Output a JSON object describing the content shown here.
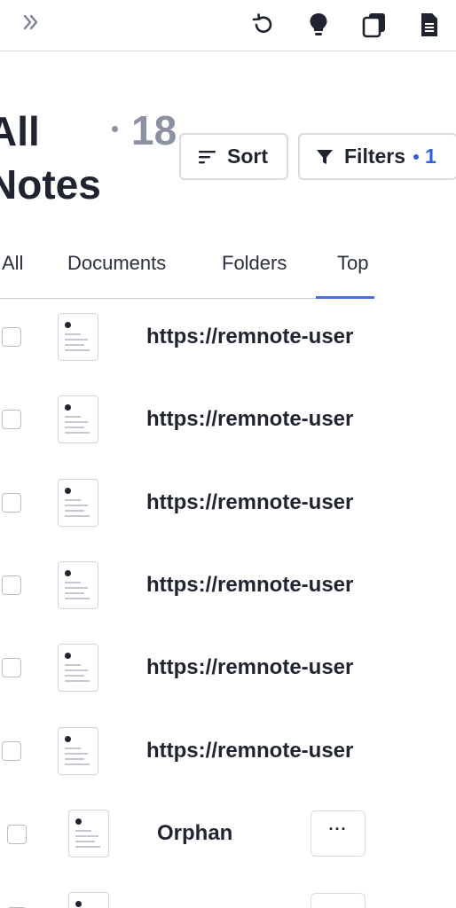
{
  "header": {
    "expand_icon": "double-chevron-right-icon",
    "icons": [
      "history-icon",
      "lightbulb-icon",
      "cards-icon",
      "document-icon"
    ]
  },
  "page": {
    "title_line1": "All",
    "title_line2": "Notes",
    "count": "18"
  },
  "toolbar": {
    "sort_label": "Sort",
    "filters_label": "Filters",
    "filters_count": "1"
  },
  "tabs": [
    {
      "label": "All"
    },
    {
      "label": "Documents"
    },
    {
      "label": "Folders"
    },
    {
      "label": "Top",
      "active": true
    }
  ],
  "rows": [
    {
      "title": "https://remnote-user"
    },
    {
      "title": "https://remnote-user"
    },
    {
      "title": "https://remnote-user"
    },
    {
      "title": "https://remnote-user"
    },
    {
      "title": "https://remnote-user"
    },
    {
      "title": "https://remnote-user"
    },
    {
      "title": "Orphan",
      "menu_label": "···"
    }
  ],
  "colors": {
    "accent": "#2f5fe0",
    "muted": "#8c91a3",
    "border": "#d9dbe2"
  }
}
